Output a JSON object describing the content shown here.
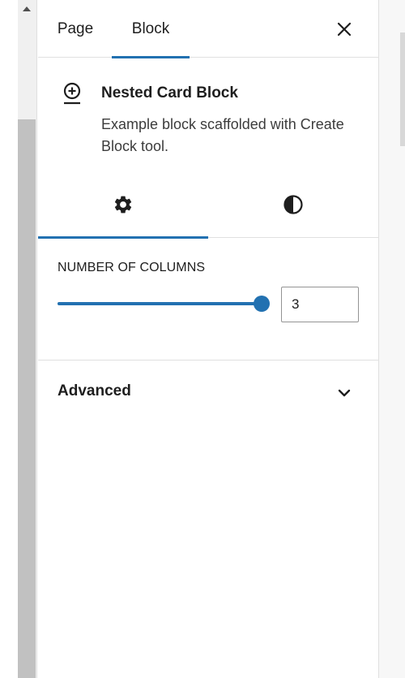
{
  "tabs": {
    "page_label": "Page",
    "block_label": "Block",
    "active": "Block"
  },
  "close_icon": "close-icon",
  "block_card": {
    "icon": "smiley-add-icon",
    "title": "Nested Card Block",
    "description": "Example block scaffolded with Create Block tool."
  },
  "inspector_tabs": [
    {
      "name": "settings",
      "icon": "gear-icon",
      "active": true
    },
    {
      "name": "styles",
      "icon": "contrast-icon",
      "active": false
    }
  ],
  "settings": {
    "columns_label": "Number of columns",
    "columns_value": "3",
    "slider_fraction": 1.0
  },
  "advanced": {
    "label": "Advanced",
    "expanded": false
  },
  "colors": {
    "accent": "#2271b1",
    "text": "#1e1e1e",
    "border": "#e0e0e0"
  }
}
